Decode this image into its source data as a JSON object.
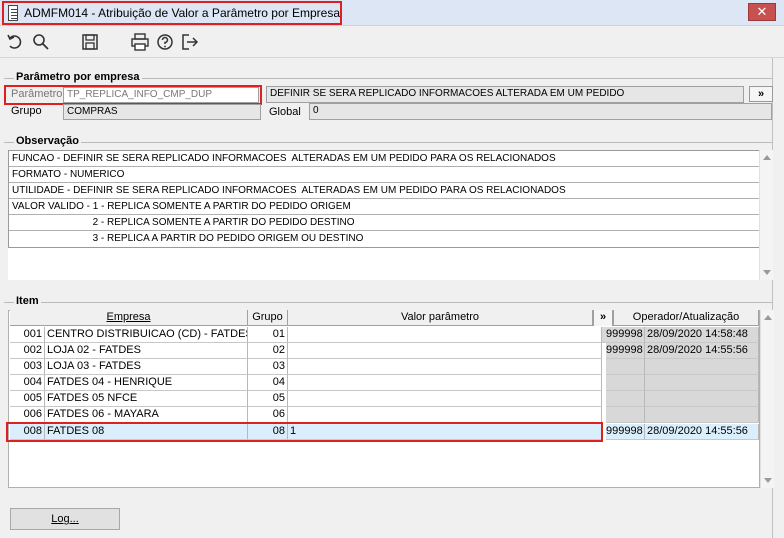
{
  "window": {
    "title": "ADMFM014 - Atribuição de Valor a Parâmetro por Empresa",
    "close_glyph": "✕"
  },
  "toolbar": {
    "icons": [
      "undo-icon",
      "search-icon",
      "save-icon",
      "print-icon",
      "help-icon",
      "exit-icon"
    ]
  },
  "parametro_section": {
    "title": "Parâmetro por empresa",
    "parametro_label": "Parâmetro",
    "parametro_value": "TP_REPLICA_INFO_CMP_DUP",
    "descricao_value": "DEFINIR SE SERA REPLICADO INFORMACOES  ALTERADA EM UM PEDIDO",
    "more_button": "»",
    "grupo_label": "Grupo",
    "grupo_value": "COMPRAS",
    "global_label": "Global",
    "global_value": "0"
  },
  "observacao_section": {
    "title": "Observação",
    "lines": [
      "FUNCAO - DEFINIR SE SERA REPLICADO INFORMACOES  ALTERADAS EM UM PEDIDO PARA OS RELACIONADOS",
      "FORMATO - NUMERICO",
      "UTILIDADE - DEFINIR SE SERA REPLICADO INFORMACOES  ALTERADAS EM UM PEDIDO PARA OS RELACIONADOS",
      "VALOR VALIDO - 1 - REPLICA SOMENTE A PARTIR DO PEDIDO ORIGEM",
      "                             2 - REPLICA SOMENTE A PARTIR DO PEDIDO DESTINO",
      "                             3 - REPLICA A PARTIR DO PEDIDO ORIGEM OU DESTINO"
    ]
  },
  "item_section": {
    "title": "Item",
    "columns": {
      "empresa": "Empresa",
      "grupo": "Grupo",
      "valor": "Valor parâmetro",
      "more": "»",
      "operador": "Operador/Atualização"
    },
    "rows": [
      {
        "code": "001",
        "empresa": "CENTRO DISTRIBUICAO (CD) - FATDES",
        "grupo": "01",
        "valor": "",
        "operador": "999998",
        "data": "28/09/2020 14:58:48"
      },
      {
        "code": "002",
        "empresa": "LOJA 02 - FATDES",
        "grupo": "02",
        "valor": "",
        "operador": "999998",
        "data": "28/09/2020 14:55:56"
      },
      {
        "code": "003",
        "empresa": "LOJA 03 - FATDES",
        "grupo": "03",
        "valor": "",
        "operador": "",
        "data": ""
      },
      {
        "code": "004",
        "empresa": "FATDES 04 - HENRIQUE",
        "grupo": "04",
        "valor": "",
        "operador": "",
        "data": ""
      },
      {
        "code": "005",
        "empresa": "FATDES 05 NFCE",
        "grupo": "05",
        "valor": "",
        "operador": "",
        "data": ""
      },
      {
        "code": "006",
        "empresa": "FATDES 06 - MAYARA",
        "grupo": "06",
        "valor": "",
        "operador": "",
        "data": ""
      },
      {
        "code": "008",
        "empresa": "FATDES 08",
        "grupo": "08",
        "valor": "1",
        "operador": "999998",
        "data": "28/09/2020 14:55:56"
      }
    ]
  },
  "footer": {
    "log_button": "Log..."
  }
}
